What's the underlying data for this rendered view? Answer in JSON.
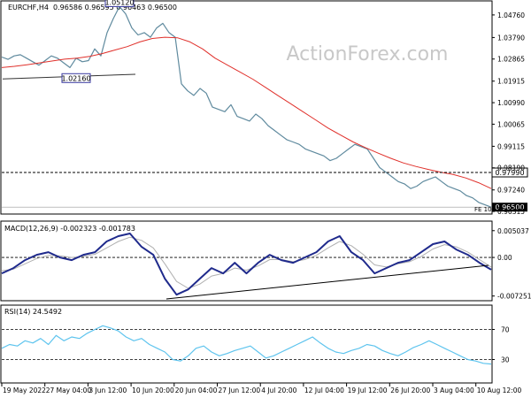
{
  "header": {
    "symbol": "EURCHF,H4",
    "ohlc": "0.96586 0.96595 0.96463 0.96500"
  },
  "watermark": "ActionForex.com",
  "colors": {
    "price_line": "#5f8a9e",
    "sma_line": "#e0302b",
    "macd_line": "#1f2a8c",
    "signal_line": "#b0b0b0",
    "rsi_line": "#5ec4ee",
    "box_border": "#3a3aa0",
    "current_price_bg": "#000000"
  },
  "chart_data": [
    {
      "type": "line",
      "panel": "price",
      "y_ticks": [
        "1.04760",
        "1.03790",
        "1.02865",
        "1.01915",
        "1.00990",
        "1.00065",
        "0.99115",
        "0.98190",
        "0.97240",
        "0.96315"
      ],
      "ylim": [
        0.9628,
        1.0525
      ],
      "series": [
        {
          "key": "price",
          "values": [
            1.0295,
            1.0285,
            1.03,
            1.0305,
            1.029,
            1.0275,
            1.026,
            1.028,
            1.03,
            1.029,
            1.027,
            1.025,
            1.029,
            1.0275,
            1.028,
            1.033,
            1.03,
            1.04,
            1.046,
            1.0512,
            1.048,
            1.042,
            1.039,
            1.04,
            1.038,
            1.042,
            1.044,
            1.04,
            1.038,
            1.018,
            1.015,
            1.013,
            1.016,
            1.014,
            1.008,
            1.007,
            1.006,
            1.009,
            1.004,
            1.003,
            1.002,
            1.005,
            1.003,
            1.0,
            0.998,
            0.996,
            0.994,
            0.993,
            0.992,
            0.99,
            0.989,
            0.988,
            0.987,
            0.985,
            0.986,
            0.988,
            0.99,
            0.992,
            0.991,
            0.99,
            0.986,
            0.982,
            0.98,
            0.978,
            0.976,
            0.975,
            0.973,
            0.974,
            0.976,
            0.977,
            0.978,
            0.976,
            0.974,
            0.973,
            0.972,
            0.97,
            0.969,
            0.967,
            0.966,
            0.965
          ]
        },
        {
          "key": "sma",
          "values": [
            1.025,
            1.0255,
            1.0262,
            1.027,
            1.0278,
            1.0286,
            1.029,
            1.0298,
            1.031,
            1.0325,
            1.034,
            1.036,
            1.0375,
            1.038,
            1.0378,
            1.036,
            1.033,
            1.029,
            1.026,
            1.023,
            1.02,
            1.0165,
            1.013,
            1.0095,
            1.006,
            1.0025,
            0.999,
            0.996,
            0.993,
            0.9905,
            0.9882,
            0.986,
            0.984,
            0.9825,
            0.9812,
            0.98,
            0.979,
            0.9775,
            0.9755,
            0.973
          ]
        }
      ],
      "annotations": [
        {
          "label": "1.05120",
          "x_index": 19,
          "y": 1.0512
        },
        {
          "label": "1.02160",
          "x_index": 12,
          "y": 1.0216
        }
      ],
      "levels": [
        {
          "label": "0.97990",
          "y": 0.9799,
          "style": "dashed"
        },
        {
          "label": "0.96500",
          "y": 0.965,
          "style": "current"
        }
      ],
      "note": "FE 100.0"
    },
    {
      "type": "line",
      "panel": "macd",
      "title": "MACD(12,26,9) -0.002323 -0.001783",
      "y_ticks": [
        "0.005037",
        "0.00",
        "-0.007251"
      ],
      "ylim": [
        -0.0078,
        0.0055
      ],
      "series": [
        {
          "key": "macd",
          "values": [
            -0.003,
            -0.002,
            -0.0005,
            0.0005,
            0.001,
            0.0,
            -0.0005,
            0.0005,
            0.001,
            0.003,
            0.004,
            0.0045,
            0.002,
            0.0005,
            -0.004,
            -0.007,
            -0.006,
            -0.004,
            -0.002,
            -0.003,
            -0.001,
            -0.003,
            -0.001,
            0.0005,
            -0.0005,
            -0.001,
            0.0,
            0.001,
            0.003,
            0.004,
            0.001,
            -0.0005,
            -0.003,
            -0.002,
            -0.001,
            -0.0005,
            0.001,
            0.0025,
            0.003,
            0.0015,
            0.0005,
            -0.001,
            -0.0023
          ]
        },
        {
          "key": "signal",
          "values": [
            -0.0025,
            -0.0022,
            -0.0012,
            -0.0002,
            0.0004,
            0.0003,
            0.0,
            0.0002,
            0.0006,
            0.0018,
            0.003,
            0.0038,
            0.0032,
            0.0018,
            -0.0012,
            -0.0045,
            -0.0058,
            -0.005,
            -0.0035,
            -0.003,
            -0.002,
            -0.0024,
            -0.0016,
            -0.0004,
            -0.0004,
            -0.0008,
            -0.0004,
            0.0004,
            0.0018,
            0.003,
            0.0022,
            0.0006,
            -0.0014,
            -0.0018,
            -0.0012,
            -0.0008,
            0.0002,
            0.0016,
            0.0024,
            0.002,
            0.001,
            -0.0004,
            -0.0018
          ]
        }
      ]
    },
    {
      "type": "line",
      "panel": "rsi",
      "title": "RSI(14) 24.5492",
      "y_ticks": [
        "70",
        "30"
      ],
      "ylim": [
        0,
        100
      ],
      "series": [
        {
          "key": "rsi",
          "values": [
            45,
            50,
            48,
            55,
            52,
            58,
            50,
            62,
            55,
            60,
            58,
            65,
            70,
            75,
            72,
            68,
            60,
            55,
            58,
            50,
            45,
            40,
            30,
            28,
            35,
            45,
            48,
            40,
            35,
            38,
            42,
            45,
            48,
            40,
            32,
            35,
            40,
            45,
            50,
            55,
            60,
            52,
            45,
            40,
            38,
            42,
            45,
            50,
            48,
            42,
            38,
            35,
            40,
            46,
            50,
            55,
            50,
            45,
            40,
            35,
            30,
            28,
            25,
            24
          ]
        }
      ]
    }
  ],
  "x_axis": {
    "labels": [
      "19 May 2022",
      "27 May 04:00",
      "3 Jun 12:00",
      "10 Jun 20:00",
      "20 Jun 04:00",
      "27 Jun 12:00",
      "4 Jul 20:00",
      "12 Jul 04:00",
      "19 Jul 12:00",
      "26 Jul 20:00",
      "3 Aug 04:00",
      "10 Aug 12:00"
    ]
  }
}
